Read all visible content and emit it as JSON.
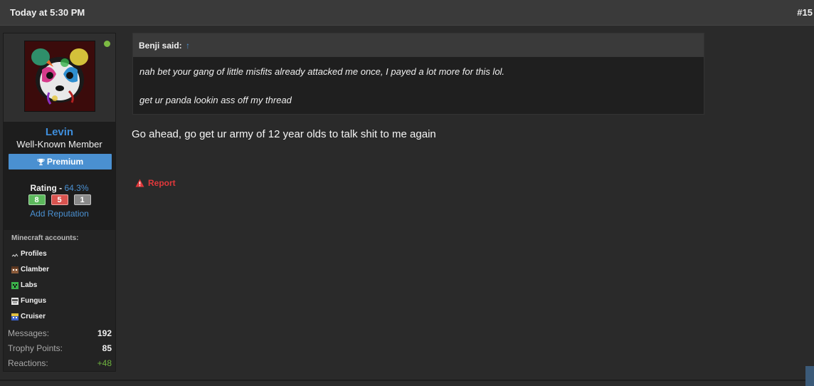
{
  "post_header": {
    "timestamp": "Today at 5:30 PM",
    "post_number": "#15"
  },
  "user": {
    "name": "Levin",
    "title": "Well-Known Member",
    "premium_label": "Premium",
    "online": true,
    "rating_label": "Rating -",
    "rating_value": "64.3%",
    "rep_positive": "8",
    "rep_negative": "5",
    "rep_neutral": "1",
    "add_reputation": "Add Reputation"
  },
  "accounts": {
    "title": "Minecraft accounts:",
    "items": [
      {
        "label": "Profiles"
      },
      {
        "label": "Clamber"
      },
      {
        "label": "Labs"
      },
      {
        "label": "Fungus"
      },
      {
        "label": "Cruiser"
      }
    ]
  },
  "stats": [
    {
      "label": "Messages:",
      "value": "192"
    },
    {
      "label": "Trophy Points:",
      "value": "85"
    },
    {
      "label": "Reactions:",
      "value": "+48"
    }
  ],
  "quote": {
    "author": "Benji said:",
    "arrow": "↑",
    "lines": [
      "nah bet your gang of little misfits already attacked me once, I payed a lot more for this lol.",
      "get ur panda lookin ass off my thread"
    ]
  },
  "post": {
    "text": "Go ahead, go get ur army of 12 year olds to talk shit to me again",
    "report_label": "Report"
  },
  "colors": {
    "accent_blue": "#4a90d1",
    "online_green": "#7cbb43",
    "report_red": "#e0383b"
  }
}
